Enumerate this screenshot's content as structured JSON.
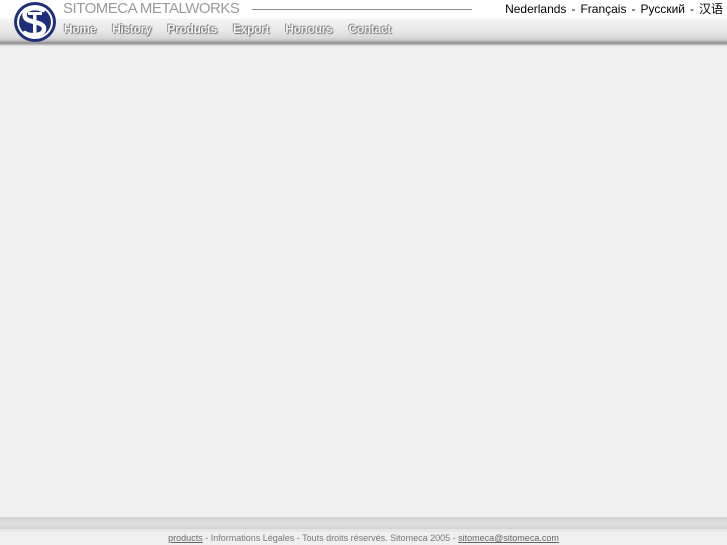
{
  "header": {
    "brand": "SITOMECA METALWORKS",
    "languages": [
      {
        "label": "Nederlands"
      },
      {
        "label": "Français"
      },
      {
        "label": "Русский"
      },
      {
        "label": "汉语"
      }
    ],
    "separator": "-"
  },
  "nav": {
    "items": [
      {
        "label": "Home"
      },
      {
        "label": "History"
      },
      {
        "label": "Products"
      },
      {
        "label": "Export"
      },
      {
        "label": "Honours"
      },
      {
        "label": "Contact"
      }
    ]
  },
  "footer": {
    "products_link": "products",
    "legal_text": " - Informations Légales - Touts droits réservés. Sitomeca 2005 - ",
    "email_link": "sitomeca@sitomeca.com"
  },
  "colors": {
    "logo_blue": "#1e2f7a",
    "background": "#efefef"
  }
}
